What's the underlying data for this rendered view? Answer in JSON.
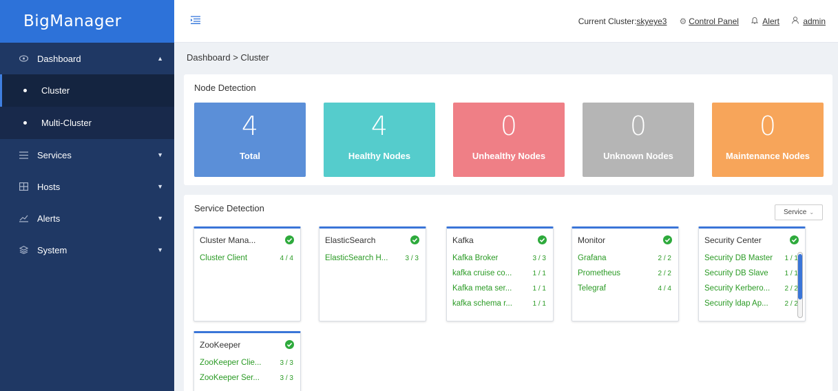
{
  "brand": "BigManager",
  "sidebar": {
    "items": [
      {
        "label": "Dashboard",
        "icon": "eye-icon",
        "open": true
      },
      {
        "label": "Services",
        "icon": "list-icon"
      },
      {
        "label": "Hosts",
        "icon": "server-icon"
      },
      {
        "label": "Alerts",
        "icon": "chart-icon"
      },
      {
        "label": "System",
        "icon": "layers-icon"
      }
    ],
    "sub_items": [
      {
        "label": "Cluster",
        "active": true
      },
      {
        "label": "Multi-Cluster"
      }
    ]
  },
  "header": {
    "cluster_label": "Current Cluster:",
    "cluster_name": "skyeye3",
    "control_panel": "Control Panel",
    "alert": "Alert",
    "user": "admin"
  },
  "breadcrumb": "Dashboard > Cluster",
  "node_detection": {
    "title": "Node Detection",
    "cards": [
      {
        "value": "4",
        "label": "Total",
        "color": "#5b8fd8"
      },
      {
        "value": "4",
        "label": "Healthy Nodes",
        "color": "#55cccc"
      },
      {
        "value": "0",
        "label": "Unhealthy Nodes",
        "color": "#ef7f86"
      },
      {
        "value": "0",
        "label": "Unknown Nodes",
        "color": "#b5b5b5"
      },
      {
        "value": "0",
        "label": "Maintenance Nodes",
        "color": "#f7a55a"
      }
    ]
  },
  "service_detection": {
    "title": "Service Detection",
    "filter": "Service",
    "services": [
      {
        "name": "Cluster Mana...",
        "rows": [
          {
            "name": "Cluster Client",
            "count": "4 / 4"
          }
        ]
      },
      {
        "name": "ElasticSearch",
        "rows": [
          {
            "name": "ElasticSearch H...",
            "count": "3 / 3"
          }
        ]
      },
      {
        "name": "Kafka",
        "rows": [
          {
            "name": "Kafka Broker",
            "count": "3 / 3"
          },
          {
            "name": "kafka cruise co...",
            "count": "1 / 1"
          },
          {
            "name": "Kafka meta ser...",
            "count": "1 / 1"
          },
          {
            "name": "kafka schema r...",
            "count": "1 / 1"
          }
        ]
      },
      {
        "name": "Monitor",
        "rows": [
          {
            "name": "Grafana",
            "count": "2 / 2"
          },
          {
            "name": "Prometheus",
            "count": "2 / 2"
          },
          {
            "name": "Telegraf",
            "count": "4 / 4"
          }
        ]
      },
      {
        "name": "Security Center",
        "rows": [
          {
            "name": "Security DB Master",
            "count": "1 / 1"
          },
          {
            "name": "Security DB Slave",
            "count": "1 / 1"
          },
          {
            "name": "Security Kerbero...",
            "count": "2 / 2"
          },
          {
            "name": "Security ldap Ap...",
            "count": "2 / 2"
          }
        ]
      },
      {
        "name": "ZooKeeper",
        "rows": [
          {
            "name": "ZooKeeper Clie...",
            "count": "3 / 3"
          },
          {
            "name": "ZooKeeper Ser...",
            "count": "3 / 3"
          }
        ]
      }
    ]
  }
}
